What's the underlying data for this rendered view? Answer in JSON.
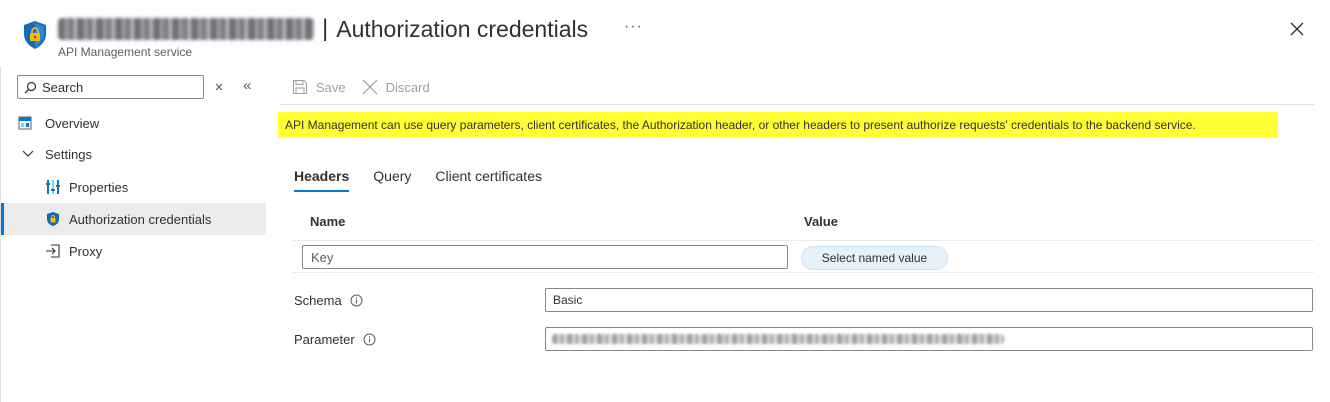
{
  "header": {
    "title": "Authorization credentials",
    "separator": "|",
    "subtitle": "API Management service",
    "more": "···"
  },
  "sidebar": {
    "search_placeholder": "Search",
    "items": [
      {
        "label": "Overview",
        "icon": "overview-icon"
      },
      {
        "label": "Settings",
        "icon": "chevron-down-icon"
      },
      {
        "label": "Properties",
        "icon": "properties-icon"
      },
      {
        "label": "Authorization credentials",
        "icon": "shield-lock-icon",
        "active": true
      },
      {
        "label": "Proxy",
        "icon": "proxy-icon"
      }
    ]
  },
  "toolbar": {
    "save_label": "Save",
    "discard_label": "Discard"
  },
  "banner": {
    "text": "API Management can use query parameters, client certificates, the Authorization header, or other headers to present authorize requests' credentials to the backend service."
  },
  "tabs": [
    {
      "label": "Headers",
      "active": true
    },
    {
      "label": "Query"
    },
    {
      "label": "Client certificates"
    }
  ],
  "headers_table": {
    "name_col": "Name",
    "value_col": "Value",
    "key_placeholder": "Key",
    "select_named_value": "Select named value"
  },
  "form": {
    "schema_label": "Schema",
    "schema_value": "Basic",
    "parameter_label": "Parameter"
  },
  "colors": {
    "accent": "#0078d4",
    "banner": "#ffff33",
    "selected_nav": "#edebe9"
  }
}
